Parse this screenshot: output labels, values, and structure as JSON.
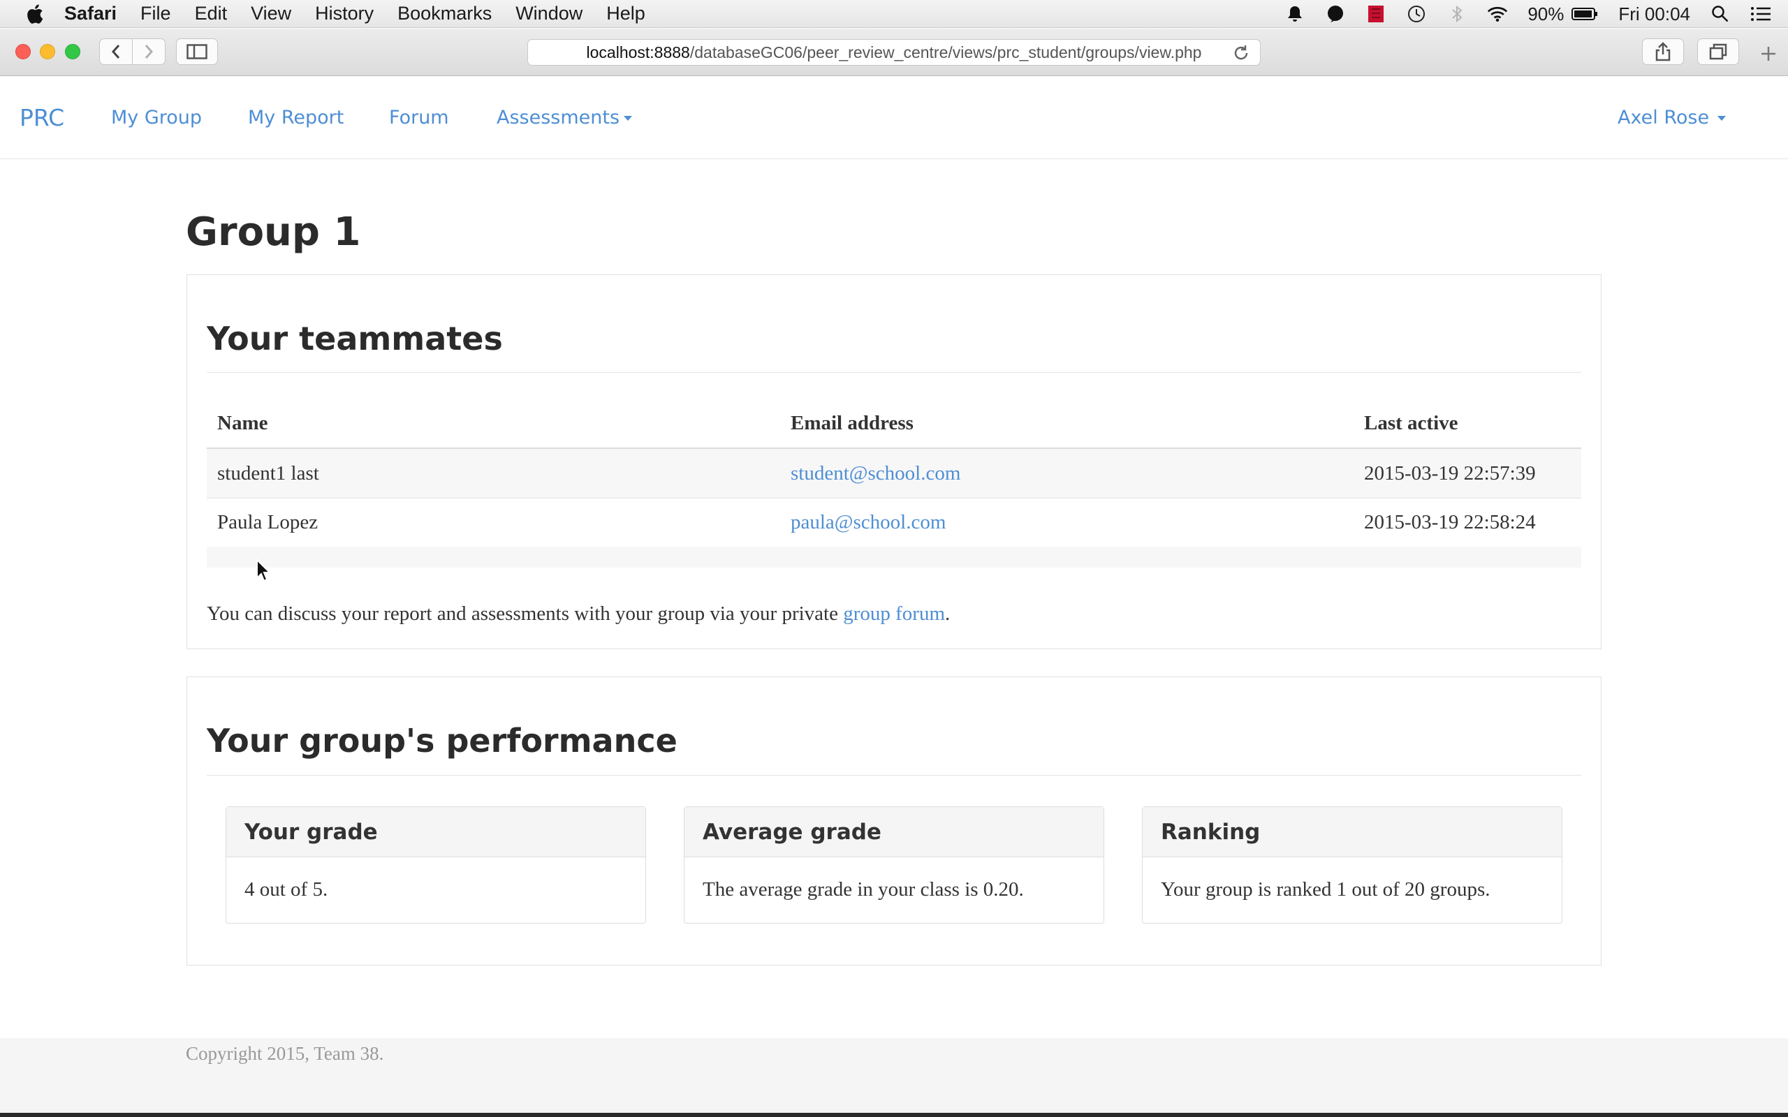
{
  "menubar": {
    "app_name": "Safari",
    "items": [
      "File",
      "Edit",
      "View",
      "History",
      "Bookmarks",
      "Window",
      "Help"
    ],
    "battery": "90%",
    "clock": "Fri 00:04"
  },
  "browser": {
    "url_host": "localhost:8888",
    "url_path": "/databaseGC06/peer_review_centre/views/prc_student/groups/view.php"
  },
  "navbar": {
    "brand": "PRC",
    "links": [
      "My Group",
      "My Report",
      "Forum",
      "Assessments"
    ],
    "user": "Axel Rose"
  },
  "page": {
    "title": "Group 1"
  },
  "teammates": {
    "heading": "Your teammates",
    "columns": [
      "Name",
      "Email address",
      "Last active"
    ],
    "rows": [
      {
        "name": "student1 last",
        "email": "student@school.com",
        "last_active": "2015-03-19 22:57:39"
      },
      {
        "name": "Paula Lopez",
        "email": "paula@school.com",
        "last_active": "2015-03-19 22:58:24"
      }
    ],
    "note_before": "You can discuss your report and assessments with your group via your private ",
    "note_link": "group forum",
    "note_after": "."
  },
  "performance": {
    "heading": "Your group's performance",
    "cards": [
      {
        "title": "Your grade",
        "body": "4 out of 5."
      },
      {
        "title": "Average grade",
        "body": "The average grade in your class is 0.20."
      },
      {
        "title": "Ranking",
        "body": "Your group is ranked 1 out of 20 groups."
      }
    ]
  },
  "footer": {
    "text": "Copyright 2015, Team 38."
  },
  "colors": {
    "link": "#4e8ed4",
    "heading": "#2b2b2b",
    "footer_bg": "#f5f5f5"
  }
}
